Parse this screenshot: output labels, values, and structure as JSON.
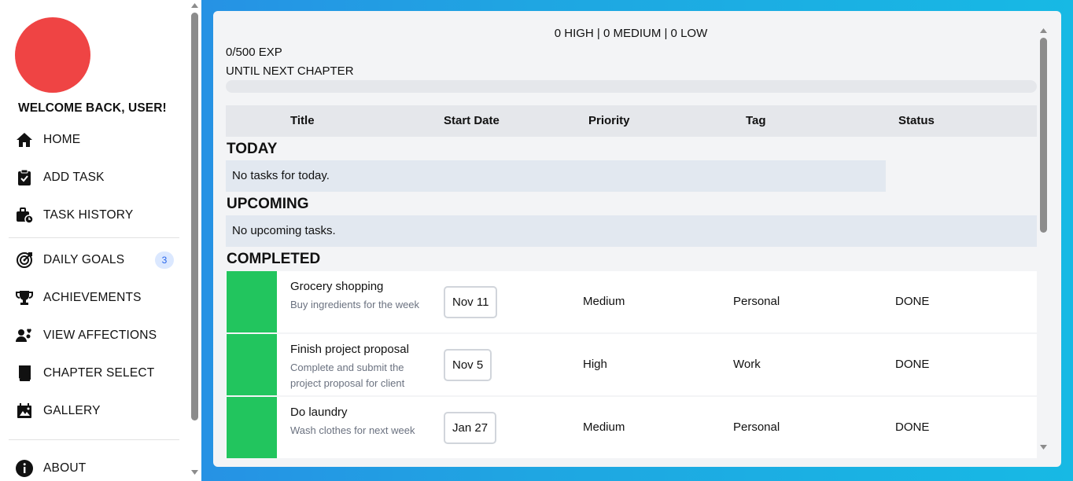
{
  "sidebar": {
    "welcome": "WELCOME BACK, USER!",
    "items": [
      {
        "label": "HOME",
        "icon": "home-icon"
      },
      {
        "label": "ADD TASK",
        "icon": "clipboard-check-icon"
      },
      {
        "label": "TASK HISTORY",
        "icon": "briefcase-clock-icon"
      },
      {
        "label": "DAILY GOALS",
        "icon": "target-arrow-icon",
        "badge": "3"
      },
      {
        "label": "ACHIEVEMENTS",
        "icon": "trophy-icon"
      },
      {
        "label": "VIEW AFFECTIONS",
        "icon": "users-heart-icon"
      },
      {
        "label": "CHAPTER SELECT",
        "icon": "book-icon"
      },
      {
        "label": "GALLERY",
        "icon": "gallery-icon"
      },
      {
        "label": "ABOUT",
        "icon": "info-icon"
      }
    ]
  },
  "stats": {
    "counts": "0 HIGH | 0 MEDIUM | 0 LOW",
    "exp": "0/500 EXP",
    "until": "UNTIL NEXT CHAPTER",
    "progress_fraction": 0
  },
  "table": {
    "headers": [
      "Title",
      "Start Date",
      "Priority",
      "Tag",
      "Status"
    ]
  },
  "sections": {
    "today": {
      "title": "TODAY",
      "empty": "No tasks for today."
    },
    "upcoming": {
      "title": "UPCOMING",
      "empty": "No upcoming tasks."
    },
    "completed": {
      "title": "COMPLETED"
    }
  },
  "tasks": [
    {
      "title": "Grocery shopping",
      "desc": "Buy ingredients for the week",
      "date": "Nov 11",
      "priority": "Medium",
      "tag": "Personal",
      "status": "DONE"
    },
    {
      "title": "Finish project proposal",
      "desc": "Complete and submit the project proposal for client",
      "date": "Nov 5",
      "priority": "High",
      "tag": "Work",
      "status": "DONE"
    },
    {
      "title": "Do laundry",
      "desc": "Wash clothes for next week",
      "date": "Jan 27",
      "priority": "Medium",
      "tag": "Personal",
      "status": "DONE"
    }
  ],
  "colors": {
    "avatar": "#ef4444",
    "task_done": "#22c55e",
    "badge_bg": "#dbe8ff",
    "badge_text": "#2563eb"
  }
}
